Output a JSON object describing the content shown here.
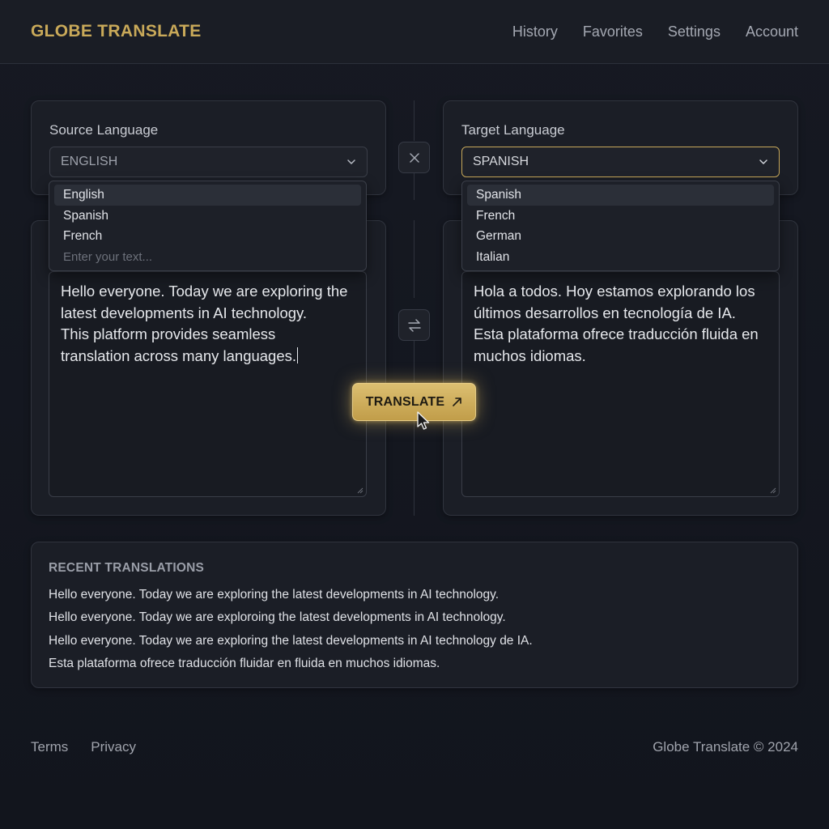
{
  "header": {
    "brand": "GLOBE TRANSLATE",
    "nav": [
      "History",
      "Favorites",
      "Settings",
      "Account"
    ]
  },
  "source": {
    "label": "Source Language",
    "selected": "ENGLISH",
    "options": [
      "English",
      "Spanish",
      "French"
    ],
    "placeholder": "Enter your text...",
    "text_lines": [
      "Hello everyone. Today we are exploring the",
      "latest developments in AI technology.",
      "This platform provides seamless",
      "translation across many languages."
    ]
  },
  "target": {
    "label": "Target Language",
    "selected": "SPANISH",
    "options": [
      "Spanish",
      "French",
      "German",
      "Italian"
    ],
    "text_lines": [
      "Hola a todos. Hoy estamos explorando los",
      "últimos desarrollos en tecnología de IA.",
      "Esta plataforma ofrece traducción fluida en",
      "muchos idiomas."
    ]
  },
  "actions": {
    "translate_label": "TRANSLATE",
    "clear_icon": "close-icon",
    "swap_icon": "swap-icon",
    "translate_icon": "arrow-up-right-icon"
  },
  "recent": {
    "title": "RECENT TRANSLATIONS",
    "items": [
      "Hello everyone. Today we are exploring the latest developments in AI technology.",
      "Hello everyone. Today we are exploroing the latest developments in AI technology.",
      "Hello everyone. Today we are exploring the latest developments in AI technology de IA.",
      "Esta plataforma ofrece traducción fluidar en fluida en muchos idiomas."
    ]
  },
  "footer": {
    "links": [
      "Terms",
      "Privacy"
    ],
    "copyright": "Globe Translate © 2024"
  },
  "colors": {
    "background": "#12151d",
    "accent_gold": "#c9a959",
    "card": "#1b1e26"
  }
}
